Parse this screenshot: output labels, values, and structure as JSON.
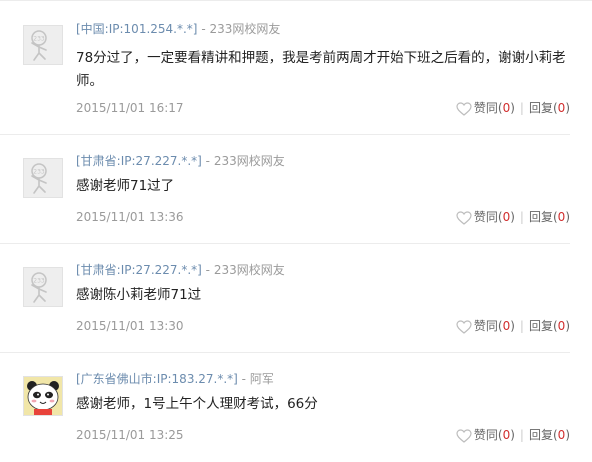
{
  "comments": [
    {
      "location": "[中国:IP:101.254.*.*]",
      "dash": "-",
      "user": "233网校网友",
      "text": "78分过了，一定要看精讲和押题，我是考前两周才开始下班之后看的，谢谢小莉老师。",
      "date": "2015/11/01 16:17",
      "like_label": "赞同",
      "like_count": "0",
      "reply_label": "回复",
      "reply_count": "0",
      "avatar": "default-233-avatar"
    },
    {
      "location": "[甘肃省:IP:27.227.*.*]",
      "dash": "-",
      "user": "233网校网友",
      "text": "感谢老师71过了",
      "date": "2015/11/01 13:36",
      "like_label": "赞同",
      "like_count": "0",
      "reply_label": "回复",
      "reply_count": "0",
      "avatar": "default-233-avatar"
    },
    {
      "location": "[甘肃省:IP:27.227.*.*]",
      "dash": "-",
      "user": "233网校网友",
      "text": "感谢陈小莉老师71过",
      "date": "2015/11/01 13:30",
      "like_label": "赞同",
      "like_count": "0",
      "reply_label": "回复",
      "reply_count": "0",
      "avatar": "default-233-avatar"
    },
    {
      "location": "[广东省佛山市:IP:183.27.*.*]",
      "dash": "-",
      "user": "阿军",
      "text": "感谢老师，1号上午个人理财考试，66分",
      "date": "2015/11/01 13:25",
      "like_label": "赞同",
      "like_count": "0",
      "reply_label": "回复",
      "reply_count": "0",
      "avatar": "panda-avatar"
    }
  ],
  "colors": {
    "location_blue": "#6c8cae",
    "count_red": "#d12e2e",
    "meta_gray": "#9a9a9a"
  }
}
